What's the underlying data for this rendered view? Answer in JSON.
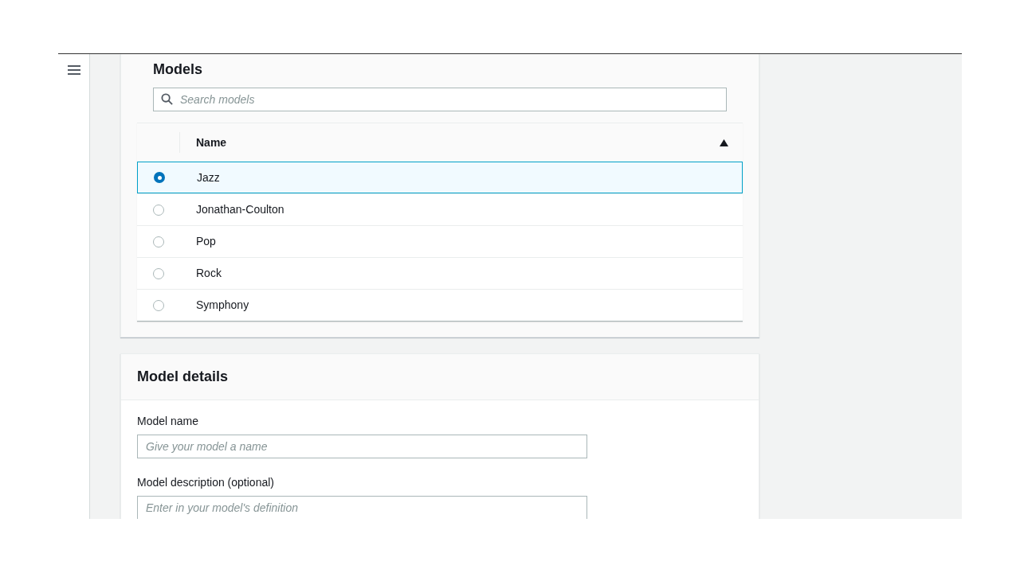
{
  "models_panel": {
    "title": "Models",
    "search": {
      "placeholder": "Search models"
    },
    "table": {
      "columns": [
        {
          "label": "Name",
          "sort_ascending": true
        }
      ],
      "rows": [
        {
          "name": "Jazz",
          "selected": true
        },
        {
          "name": "Jonathan-Coulton",
          "selected": false
        },
        {
          "name": "Pop",
          "selected": false
        },
        {
          "name": "Rock",
          "selected": false
        },
        {
          "name": "Symphony",
          "selected": false
        }
      ]
    }
  },
  "details_panel": {
    "title": "Model details",
    "fields": [
      {
        "label": "Model name",
        "placeholder": "Give your model a name"
      },
      {
        "label": "Model description (optional)",
        "placeholder": "Enter in your model's definition"
      }
    ]
  }
}
